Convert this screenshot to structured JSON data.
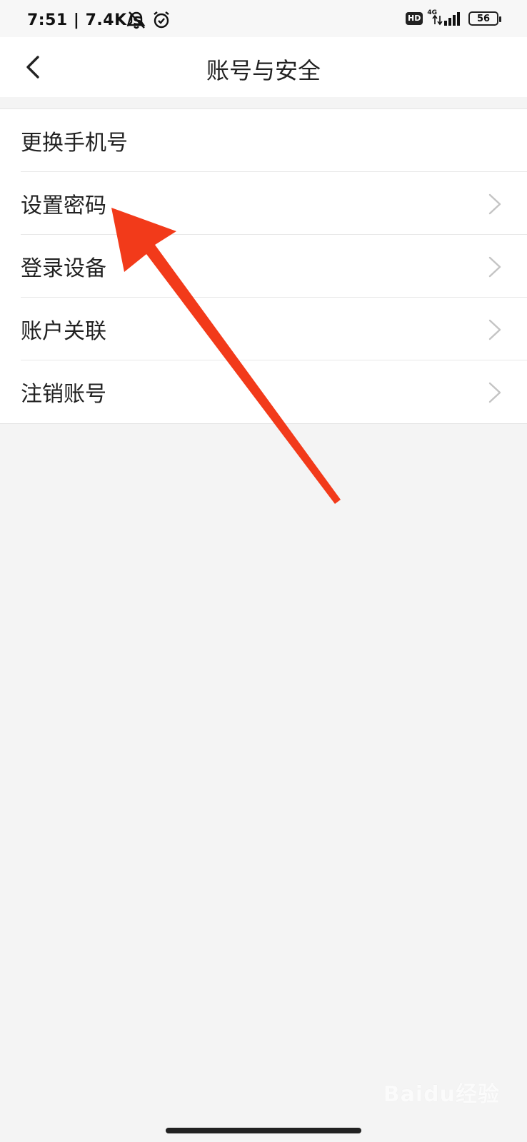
{
  "status_bar": {
    "time": "7:51",
    "speed": "7.4K/s",
    "left_icons": [
      "bell-muted-icon",
      "alarm-icon"
    ],
    "hd": "HD",
    "network": "4G",
    "battery": "56"
  },
  "header": {
    "title": "账号与安全",
    "back_icon": "chevron-left-icon"
  },
  "menu": {
    "items": [
      {
        "label": "更换手机号",
        "has_chevron": false
      },
      {
        "label": "设置密码",
        "has_chevron": true
      },
      {
        "label": "登录设备",
        "has_chevron": true
      },
      {
        "label": "账户关联",
        "has_chevron": true
      },
      {
        "label": "注销账号",
        "has_chevron": true
      }
    ]
  },
  "annotation": {
    "type": "arrow",
    "color": "#f23a1a",
    "points_to": "设置密码"
  },
  "watermark": {
    "text": "Baidu经验"
  },
  "colors": {
    "background": "#f4f4f4",
    "surface": "#ffffff",
    "text": "#222222",
    "chevron": "#c4c4c4",
    "arrow": "#f23a1a"
  }
}
